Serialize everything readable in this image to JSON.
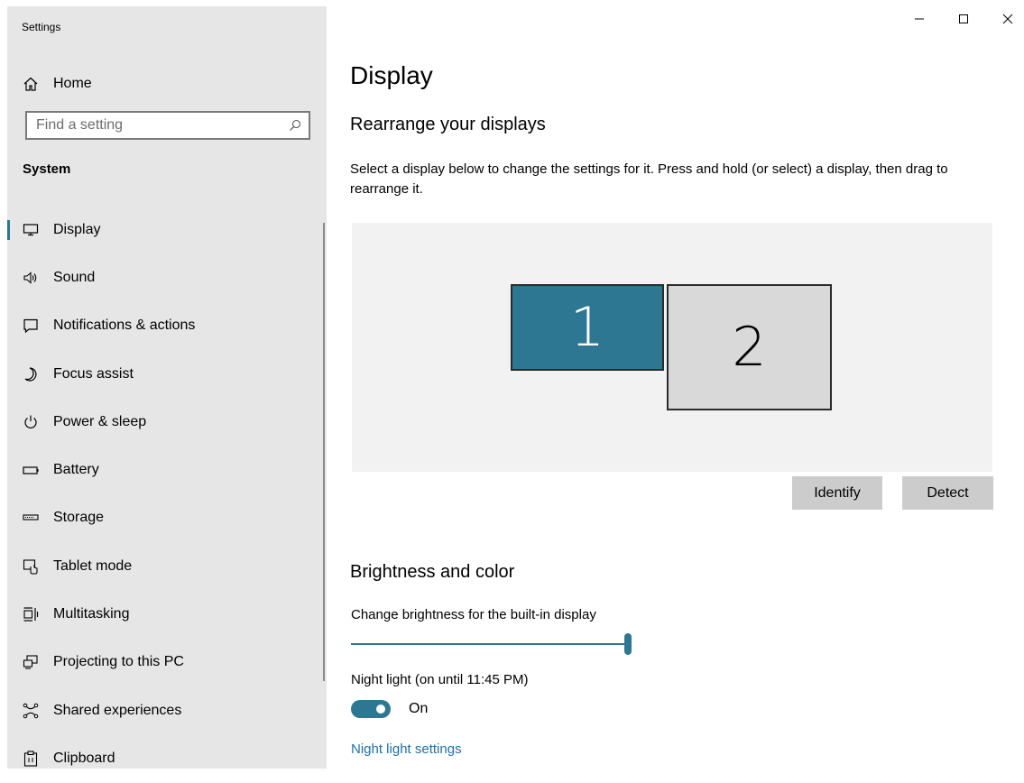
{
  "app": {
    "title": "Settings"
  },
  "window_controls": {
    "minimize": "minimize-icon",
    "maximize": "maximize-icon",
    "close": "close-icon"
  },
  "sidebar": {
    "home_label": "Home",
    "search_placeholder": "Find a setting",
    "section_label": "System",
    "items": [
      {
        "label": "Display",
        "icon": "display-icon",
        "selected": true
      },
      {
        "label": "Sound",
        "icon": "sound-icon"
      },
      {
        "label": "Notifications & actions",
        "icon": "notifications-icon"
      },
      {
        "label": "Focus assist",
        "icon": "moon-icon"
      },
      {
        "label": "Power & sleep",
        "icon": "power-icon"
      },
      {
        "label": "Battery",
        "icon": "battery-icon"
      },
      {
        "label": "Storage",
        "icon": "storage-icon"
      },
      {
        "label": "Tablet mode",
        "icon": "tablet-mode-icon"
      },
      {
        "label": "Multitasking",
        "icon": "multitasking-icon"
      },
      {
        "label": "Projecting to this PC",
        "icon": "projecting-icon"
      },
      {
        "label": "Shared experiences",
        "icon": "shared-experiences-icon"
      },
      {
        "label": "Clipboard",
        "icon": "clipboard-icon"
      }
    ]
  },
  "main": {
    "title": "Display",
    "rearrange": {
      "heading": "Rearrange your displays",
      "description": "Select a display below to change the settings for it. Press and hold (or select) a display, then drag to rearrange it.",
      "monitor1": "1",
      "monitor2": "2",
      "identify_label": "Identify",
      "detect_label": "Detect"
    },
    "brightness": {
      "heading": "Brightness and color",
      "slider_label": "Change brightness for the built-in display",
      "slider_value": 100,
      "night_light_label": "Night light (on until 11:45 PM)",
      "toggle_state": "On",
      "night_light_link": "Night light settings"
    }
  },
  "colors": {
    "accent": "#2e7792",
    "sidebar_bg": "#e6e6e6",
    "arrange_bg": "#f2f2f2",
    "link": "#1e6fa8"
  }
}
